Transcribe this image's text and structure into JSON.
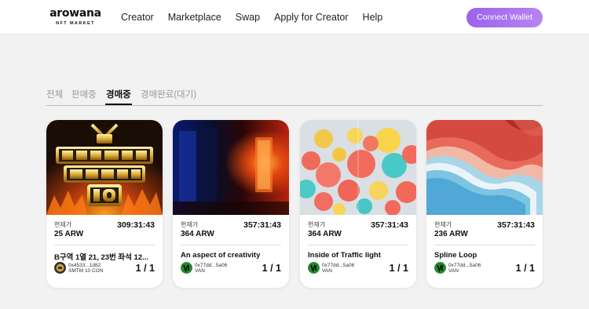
{
  "header": {
    "logo": "arowana",
    "logo_sub": "NFT MARKET",
    "nav": [
      "Creator",
      "Marketplace",
      "Swap",
      "Apply for Creator",
      "Help"
    ],
    "connect_label": "Connect Wallet"
  },
  "tabs": {
    "items": [
      "전체",
      "판매중",
      "경매중",
      "경매완료(대기)"
    ],
    "active": "경매중"
  },
  "cards": [
    {
      "price_label": "현재가",
      "price": "25 ARW",
      "timer": "309:31:43",
      "title": "B구역 1열 21, 23번 좌석 12...",
      "owner_addr": "0x4533...1d82",
      "owner_name": "SMTM 10 CON",
      "edition": "1 / 1",
      "image": "show-me-the-money-10"
    },
    {
      "price_label": "현재가",
      "price": "364 ARW",
      "timer": "357:31:43",
      "title": "An aspect of creativity",
      "owner_addr": "0x77dd...5a06",
      "owner_name": "VAN",
      "edition": "1 / 1",
      "image": "red-blue-room"
    },
    {
      "price_label": "현재가",
      "price": "364 ARW",
      "timer": "357:31:43",
      "title": "Inside of Traffic light",
      "owner_addr": "0x77dd...5a06",
      "owner_name": "VAN",
      "edition": "1 / 1",
      "image": "colorful-balls"
    },
    {
      "price_label": "현재가",
      "price": "236 ARW",
      "timer": "357:31:43",
      "title": "Spline Loop",
      "owner_addr": "0x77dd...5a06",
      "owner_name": "VAN",
      "edition": "1 / 1",
      "image": "spline-layers"
    }
  ],
  "colors": {
    "accent": "#a06ef0",
    "van_avatar": "#1f8a2c"
  }
}
